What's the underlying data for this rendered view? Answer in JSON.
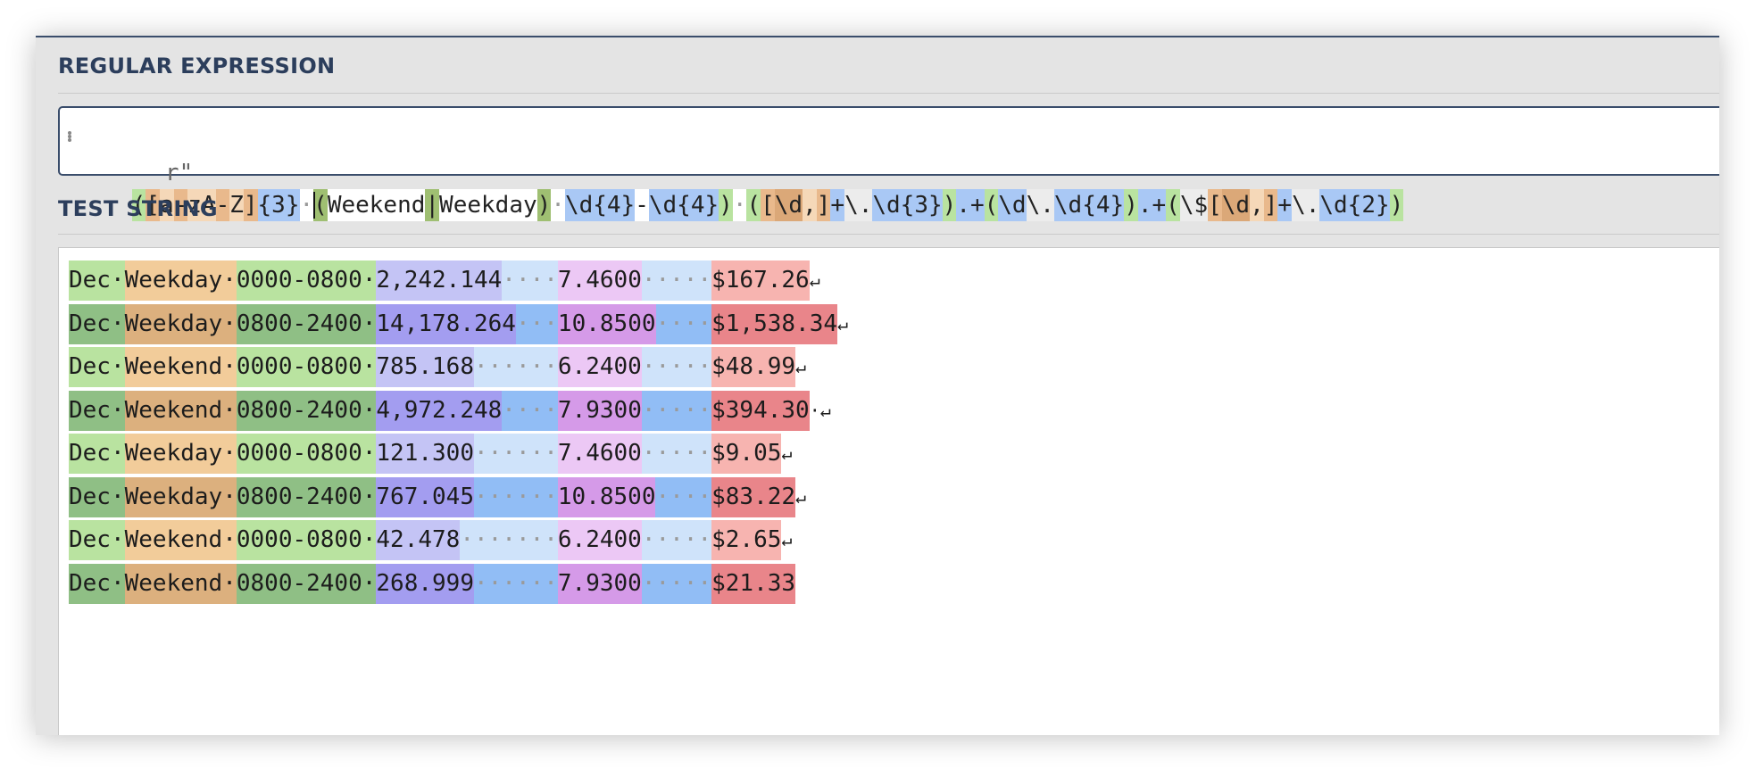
{
  "labels": {
    "regex": "REGULAR EXPRESSION",
    "test": "TEST STRING"
  },
  "regex": {
    "prefix": "r\"",
    "tokens": [
      {
        "t": "(",
        "c": "#b9e3a0"
      },
      {
        "t": "[",
        "c": "#e9b98c"
      },
      {
        "t": "a",
        "c": "#f5d8b8"
      },
      {
        "t": "-",
        "c": "#e9b98c"
      },
      {
        "t": "z",
        "c": "#f5d8b8"
      },
      {
        "t": "A",
        "c": "#f5d8b8"
      },
      {
        "t": "-",
        "c": "#e9b98c"
      },
      {
        "t": "Z",
        "c": "#f5d8b8"
      },
      {
        "t": "]",
        "c": "#e9b98c"
      },
      {
        "t": "{3}",
        "c": "#a9c8f5"
      },
      {
        "t": "·",
        "c": "#ffffff",
        "dot": true
      },
      {
        "t": "(",
        "c": "#9fbf72",
        "cursor": true
      },
      {
        "t": "Weekend",
        "c": "#ffffff"
      },
      {
        "t": "|",
        "c": "#9fbf72"
      },
      {
        "t": "Weekday",
        "c": "#ffffff"
      },
      {
        "t": ")",
        "c": "#9fbf72"
      },
      {
        "t": "·",
        "c": "#ffffff",
        "dot": true
      },
      {
        "t": "\\d{4}",
        "c": "#a9c8f5"
      },
      {
        "t": "-",
        "c": "#ffffff"
      },
      {
        "t": "\\d{4}",
        "c": "#a9c8f5"
      },
      {
        "t": ")",
        "c": "#b9e3a0"
      },
      {
        "t": "·",
        "c": "#ffffff",
        "dot": true
      },
      {
        "t": "(",
        "c": "#b9e3a0"
      },
      {
        "t": "[",
        "c": "#e9b98c"
      },
      {
        "t": "\\d",
        "c": "#dba878"
      },
      {
        "t": ",",
        "c": "#f5d8b8"
      },
      {
        "t": "]",
        "c": "#e9b98c"
      },
      {
        "t": "+",
        "c": "#a9c8f5"
      },
      {
        "t": "\\.",
        "c": "#ececec"
      },
      {
        "t": "\\d{3}",
        "c": "#a9c8f5"
      },
      {
        "t": ")",
        "c": "#b9e3a0"
      },
      {
        "t": ".+",
        "c": "#a9c8f5"
      },
      {
        "t": "(",
        "c": "#b9e3a0"
      },
      {
        "t": "\\d",
        "c": "#a9c8f5"
      },
      {
        "t": "\\.",
        "c": "#ececec"
      },
      {
        "t": "\\d{4}",
        "c": "#a9c8f5"
      },
      {
        "t": ")",
        "c": "#b9e3a0"
      },
      {
        "t": ".+",
        "c": "#a9c8f5"
      },
      {
        "t": "(",
        "c": "#b9e3a0"
      },
      {
        "t": "\\$",
        "c": "#ececec"
      },
      {
        "t": "[",
        "c": "#e9b98c"
      },
      {
        "t": "\\d",
        "c": "#dba878"
      },
      {
        "t": ",",
        "c": "#f5d8b8"
      },
      {
        "t": "]",
        "c": "#e9b98c"
      },
      {
        "t": "+",
        "c": "#a9c8f5"
      },
      {
        "t": "\\.",
        "c": "#ececec"
      },
      {
        "t": "\\d{2}",
        "c": "#a9c8f5"
      },
      {
        "t": ")",
        "c": "#b9e3a0"
      }
    ]
  },
  "test_lines": [
    {
      "month": "Dec",
      "day": "Weekday",
      "time": "0000-0800",
      "g3": "2,242.144",
      "gap1": "····",
      "g4": "7.4600",
      "gap2": "·····",
      "g5": "$167.26",
      "tail": "↵"
    },
    {
      "month": "Dec",
      "day": "Weekday",
      "time": "0800-2400",
      "g3": "14,178.264",
      "gap1": "···",
      "g4": "10.8500",
      "gap2": "····",
      "g5": "$1,538.34",
      "tail": "↵"
    },
    {
      "month": "Dec",
      "day": "Weekend",
      "time": "0000-0800",
      "g3": "785.168",
      "gap1": "······",
      "g4": "6.2400",
      "gap2": "·····",
      "g5": "$48.99",
      "tail": "↵"
    },
    {
      "month": "Dec",
      "day": "Weekend",
      "time": "0800-2400",
      "g3": "4,972.248",
      "gap1": "····",
      "g4": "7.9300",
      "gap2": "·····",
      "g5": "$394.30",
      "tail": "·↵"
    },
    {
      "month": "Dec",
      "day": "Weekday",
      "time": "0000-0800",
      "g3": "121.300",
      "gap1": "······",
      "g4": "7.4600",
      "gap2": "·····",
      "g5": "$9.05",
      "tail": "↵"
    },
    {
      "month": "Dec",
      "day": "Weekday",
      "time": "0800-2400",
      "g3": "767.045",
      "gap1": "······",
      "g4": "10.8500",
      "gap2": "····",
      "g5": "$83.22",
      "tail": "↵"
    },
    {
      "month": "Dec",
      "day": "Weekend",
      "time": "0000-0800",
      "g3": "42.478",
      "gap1": "·······",
      "g4": "6.2400",
      "gap2": "·····",
      "g5": "$2.65",
      "tail": "↵"
    },
    {
      "month": "Dec",
      "day": "Weekend",
      "time": "0800-2400",
      "g3": "268.999",
      "gap1": "······",
      "g4": "7.9300",
      "gap2": "·····",
      "g5": "$21.33",
      "tail": ""
    }
  ],
  "colors": {
    "odd": {
      "month": "#b9e3a0",
      "day": "#f2cc9a",
      "time": "#b9e3a0",
      "g3": "#c4c4f5",
      "gap1": "#cfe3fa",
      "g4": "#ecc8f5",
      "gap2": "#cfe3fa",
      "g5": "#f7b4b0"
    },
    "even": {
      "month": "#8fbf85",
      "day": "#dcb07e",
      "time": "#8fbf85",
      "g3": "#a39df0",
      "gap1": "#91bdf5",
      "g4": "#d59ae8",
      "gap2": "#91bdf5",
      "g5": "#e9858a"
    }
  }
}
